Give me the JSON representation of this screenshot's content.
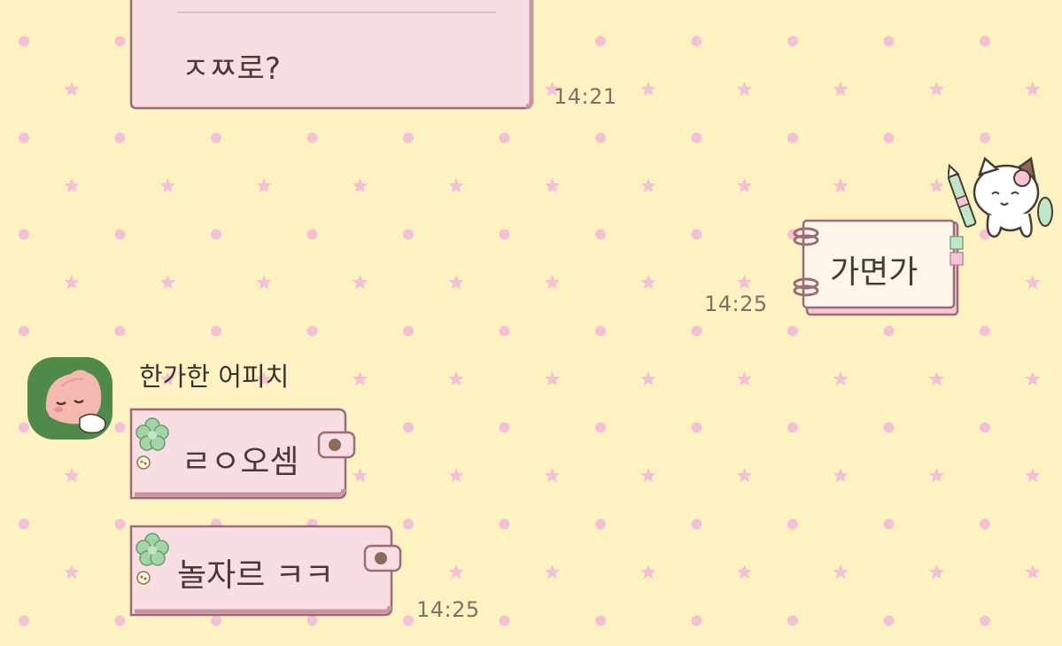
{
  "chat": {
    "messages": [
      {
        "id": "incoming-1",
        "direction": "incoming",
        "text": "ㅈㅉ로?",
        "time": "14:21"
      },
      {
        "id": "outgoing-1",
        "direction": "outgoing",
        "text": "가면가",
        "time": "14:25"
      },
      {
        "id": "incoming-2",
        "direction": "incoming",
        "sender": "한가한 어피치",
        "text": "ㄹㅇ오셈"
      },
      {
        "id": "incoming-3",
        "direction": "incoming",
        "text": "놀자르 ㅋㅋ",
        "time": "14:25"
      }
    ]
  },
  "theme": {
    "background": "#fdf2c1",
    "pattern_color": "#f3c0d6",
    "bubble_fill": "#f8dde3",
    "bubble_border": "#9d6a7a",
    "button_green": "#a3d4a5",
    "avatar_bg": "#4f8a4a"
  },
  "icons": {
    "avatar": "peach-character-avatar",
    "sticker": "cat-with-pen-sticker",
    "notebook_rings": "notebook-ring-icon",
    "flower_button": "flower-button-icon",
    "snap_button": "snap-button-icon"
  }
}
